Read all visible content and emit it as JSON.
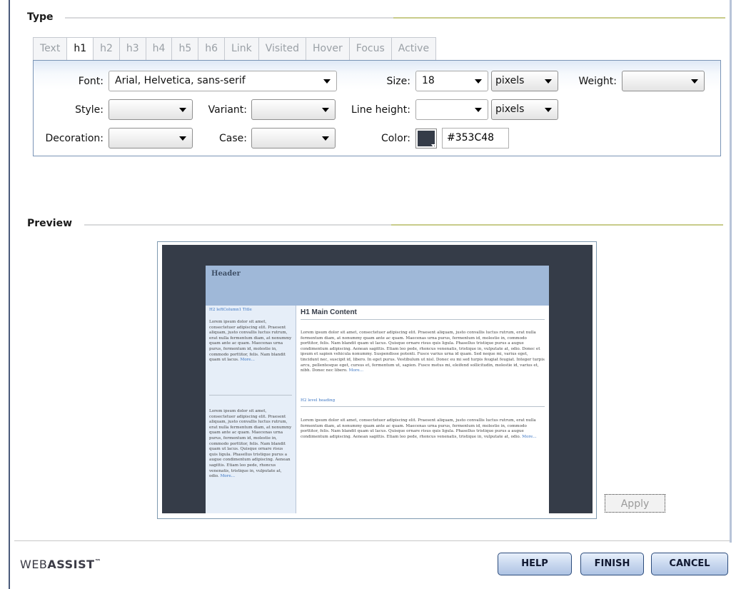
{
  "type_section": {
    "title": "Type",
    "tabs": [
      {
        "label": "Text",
        "active": false
      },
      {
        "label": "h1",
        "active": true
      },
      {
        "label": "h2",
        "active": false
      },
      {
        "label": "h3",
        "active": false
      },
      {
        "label": "h4",
        "active": false
      },
      {
        "label": "h5",
        "active": false
      },
      {
        "label": "h6",
        "active": false
      },
      {
        "label": "Link",
        "active": false
      },
      {
        "label": "Visited",
        "active": false
      },
      {
        "label": "Hover",
        "active": false
      },
      {
        "label": "Focus",
        "active": false
      },
      {
        "label": "Active",
        "active": false
      }
    ],
    "font": {
      "label": "Font:",
      "value": "Arial, Helvetica, sans-serif"
    },
    "size": {
      "label": "Size:",
      "value": "18",
      "unit": "pixels"
    },
    "weight": {
      "label": "Weight:",
      "value": ""
    },
    "style": {
      "label": "Style:",
      "value": ""
    },
    "variant": {
      "label": "Variant:",
      "value": ""
    },
    "line_height": {
      "label": "Line height:",
      "value": "",
      "unit": "pixels"
    },
    "decoration": {
      "label": "Decoration:",
      "value": ""
    },
    "case": {
      "label": "Case:",
      "value": ""
    },
    "color": {
      "label": "Color:",
      "value": "#353C48",
      "swatch": "#353C48"
    }
  },
  "preview_section": {
    "title": "Preview",
    "preview": {
      "header": "Header",
      "left_title": "H2 leftColumn1 Title",
      "left_text1": "Lorem ipsum dolor sit amet, consectetuer adipiscing elit. Praesent aliquam, justo convallis luctus rutrum, erat nulla fermentum diam, at nonummy quam ante ac quam. Maecenas urna purus, fermentum id, molestie in, commodo porttitor, felis. Nam blandit quam ut lacus.",
      "left_text2": "Lorem ipsum dolor sit amet, consectetuer adipiscing elit. Praesent aliquam, justo convallis luctus rutrum, erat nulla fermentum diam, at nonummy quam ante ac quam. Maecenas urna purus, fermentum id, molestie in, commodo porttitor, felis. Nam blandit quam ut lacus. Quisque ornare risus quis ligula. Phasellus tristique purus a augue condimentum adipiscing. Aenean sagittis. Etiam leo pede, rhoncus venenatis, tristique in, vulputate at, odio.",
      "more": "More...",
      "main_title": "H1 Main Content",
      "main_text1": "Lorem ipsum dolor sit amet, consectetuer adipiscing elit. Praesent aliquam, justo convallis luctus rutrum, erat nulla fermentum diam, at nonummy quam ante ac quam. Maecenas urna purus, fermentum id, molestie in, commodo porttitor, felis. Nam blandit quam ut lacus. Quisque ornare risus quis ligula. Phasellus tristique purus a augue condimentum adipiscing. Aenean sagittis. Etiam leo pede, rhoncus venenatis, tristique in, vulputate at, odio. Donec et ipsum et sapien vehicula nonummy. Suspendisse potenti. Fusce varius urna id quam. Sed neque mi, varius eget, tincidunt nec, suscipit id, libero. In eget purus. Vestibulum ut nisl. Donec eu mi sed turpis feugiat feugiat. Integer turpis arcu, pellentesque eget, cursus et, fermentum ut, sapien. Fusce metus mi, eleifend sollicitudin, molestie id, varius et, nibh. Donec nec libero.",
      "main_h2": "H2 level heading",
      "main_text2": "Lorem ipsum dolor sit amet, consectetuer adipiscing elit. Praesent aliquam, justo convallis luctus rutrum, erat nulla fermentum diam, at nonummy quam ante ac quam. Maecenas urna purus, fermentum id, molestie in, commodo porttitor, felis. Nam blandit quam ut lacus. Quisque ornare risus quis ligula. Phasellus tristique purus a augue condimentum adipiscing. Aenean sagittis. Etiam leo pede, rhoncus venenatis, tristique in, vulputate at, odio."
    },
    "apply_label": "Apply"
  },
  "footer": {
    "logo_part1": "WEB",
    "logo_part2": "ASSIST",
    "logo_tm": "™",
    "help_label": "HELP",
    "finish_label": "FINISH",
    "cancel_label": "CANCEL"
  },
  "colors": {
    "accent_line": "#c8cc8a",
    "tab_border": "#7a94b6",
    "preview_background": "#353C48",
    "preview_header": "#9fb8d8"
  }
}
